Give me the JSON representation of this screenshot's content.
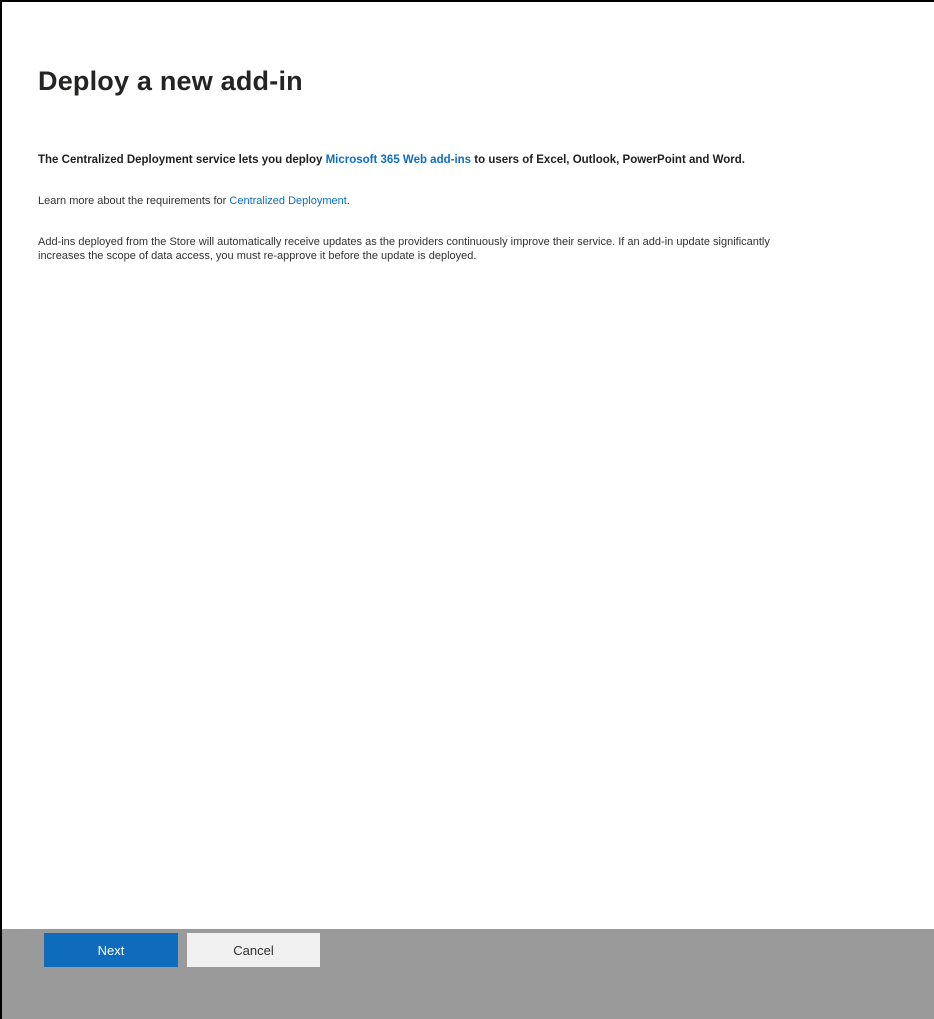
{
  "panel": {
    "title": "Deploy a new add-in"
  },
  "intro": {
    "prefix": "The Centralized Deployment service lets you deploy ",
    "link": "Microsoft 365 Web add-ins",
    "suffix": " to users of Excel, Outlook, PowerPoint and Word."
  },
  "learn_more": {
    "prefix": "Learn more about the requirements for ",
    "link": "Centralized Deployment",
    "suffix": "."
  },
  "updates": {
    "line1": "Add-ins deployed from the Store will automatically receive updates as the providers continuously improve their service. If an add-in update significantly",
    "line2": "increases the scope of data access, you must re-approve it before the update is deployed."
  },
  "footer": {
    "next_label": "Next",
    "cancel_label": "Cancel"
  },
  "colors": {
    "accent": "#0f6cbd",
    "footer_bg": "#9a9a9a",
    "secondary_button_bg": "#f0f0f0"
  }
}
